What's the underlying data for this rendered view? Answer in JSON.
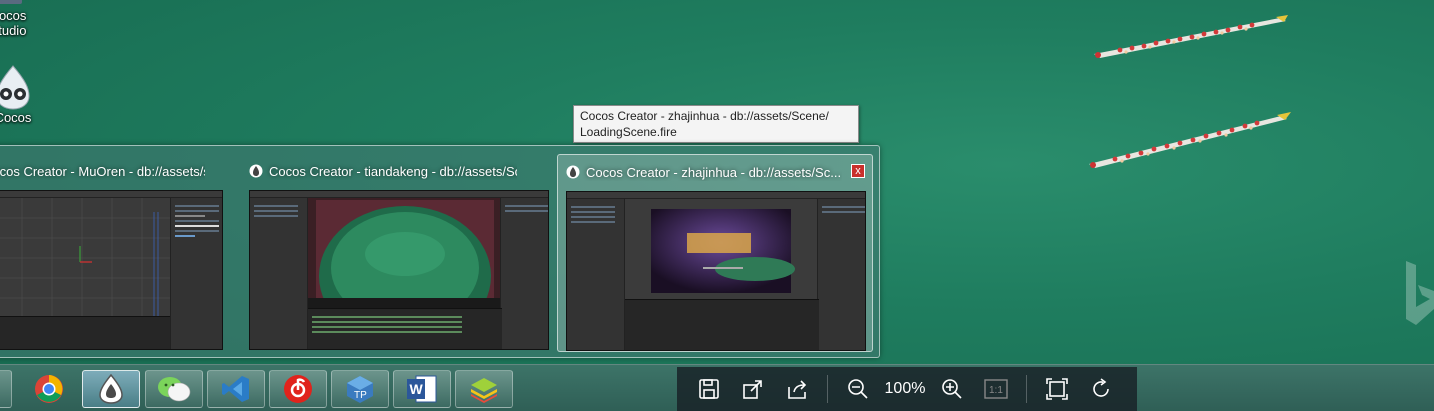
{
  "desktop": {
    "icons": [
      {
        "label_line1": "Cocos",
        "label_line2": "Studio"
      },
      {
        "label": "Cocos"
      }
    ]
  },
  "tooltip": {
    "line1": "Cocos Creator - zhajinhua - db://assets/Scene/",
    "line2": "LoadingScene.fire"
  },
  "thumbnails": [
    {
      "title": "Cocos Creator - MuOren - db://assets/scene/..."
    },
    {
      "title": "Cocos Creator - tiandakeng - db://assets/Sce..."
    },
    {
      "title": "Cocos Creator - zhajinhua - db://assets/Sc...",
      "close_label": "x"
    }
  ],
  "taskbar": {
    "apps": [
      "chrome-icon",
      "cocos-creator-icon",
      "wechat-icon",
      "vscode-icon",
      "netease-music-icon",
      "texturepacker-icon",
      "word-icon",
      "bluestacks-icon"
    ]
  },
  "viewer_toolbar": {
    "zoom_level": "100%",
    "actual_size_label": "1:1"
  },
  "colors": {
    "desktop": "#1e7a5c",
    "taskbar": "#3d7468",
    "viewer_bar": "#19232b"
  }
}
